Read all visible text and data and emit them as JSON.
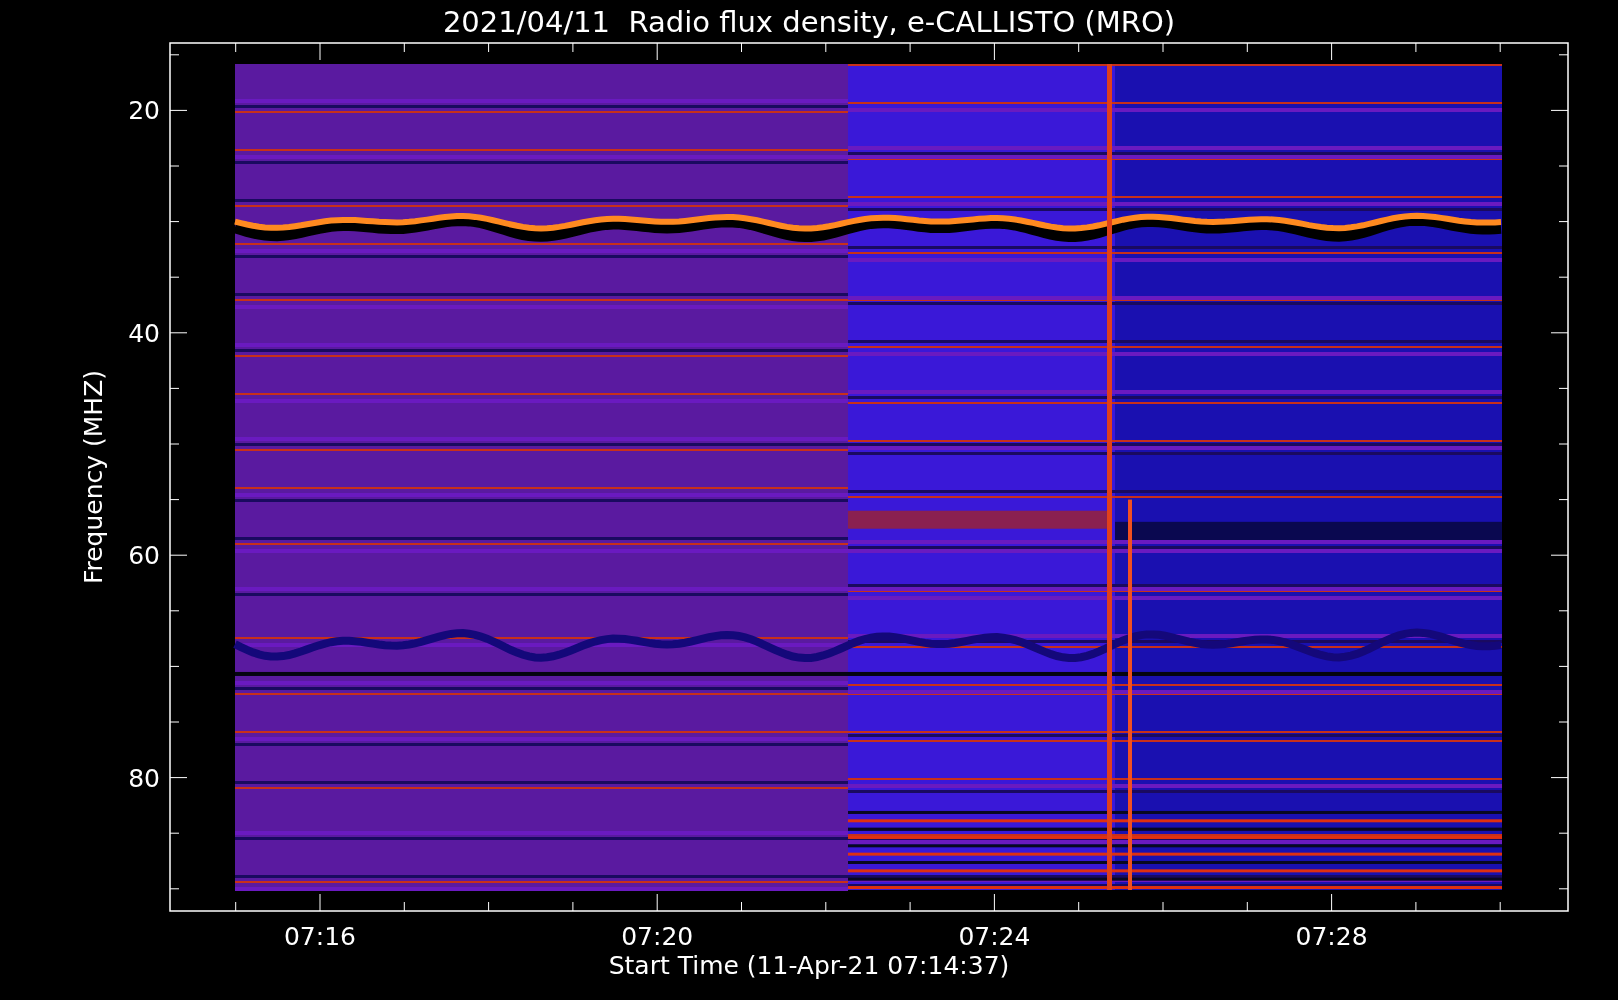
{
  "title": "2021/04/11  Radio flux density, e-CALLISTO (MRO)",
  "ylabel": "Frequency (MHZ)",
  "xlabel": "Start Time (11-Apr-21 07:14:37)",
  "yticks": [
    "20",
    "40",
    "60",
    "80"
  ],
  "xticks": [
    "07:16",
    "07:20",
    "07:24",
    "07:28"
  ]
}
